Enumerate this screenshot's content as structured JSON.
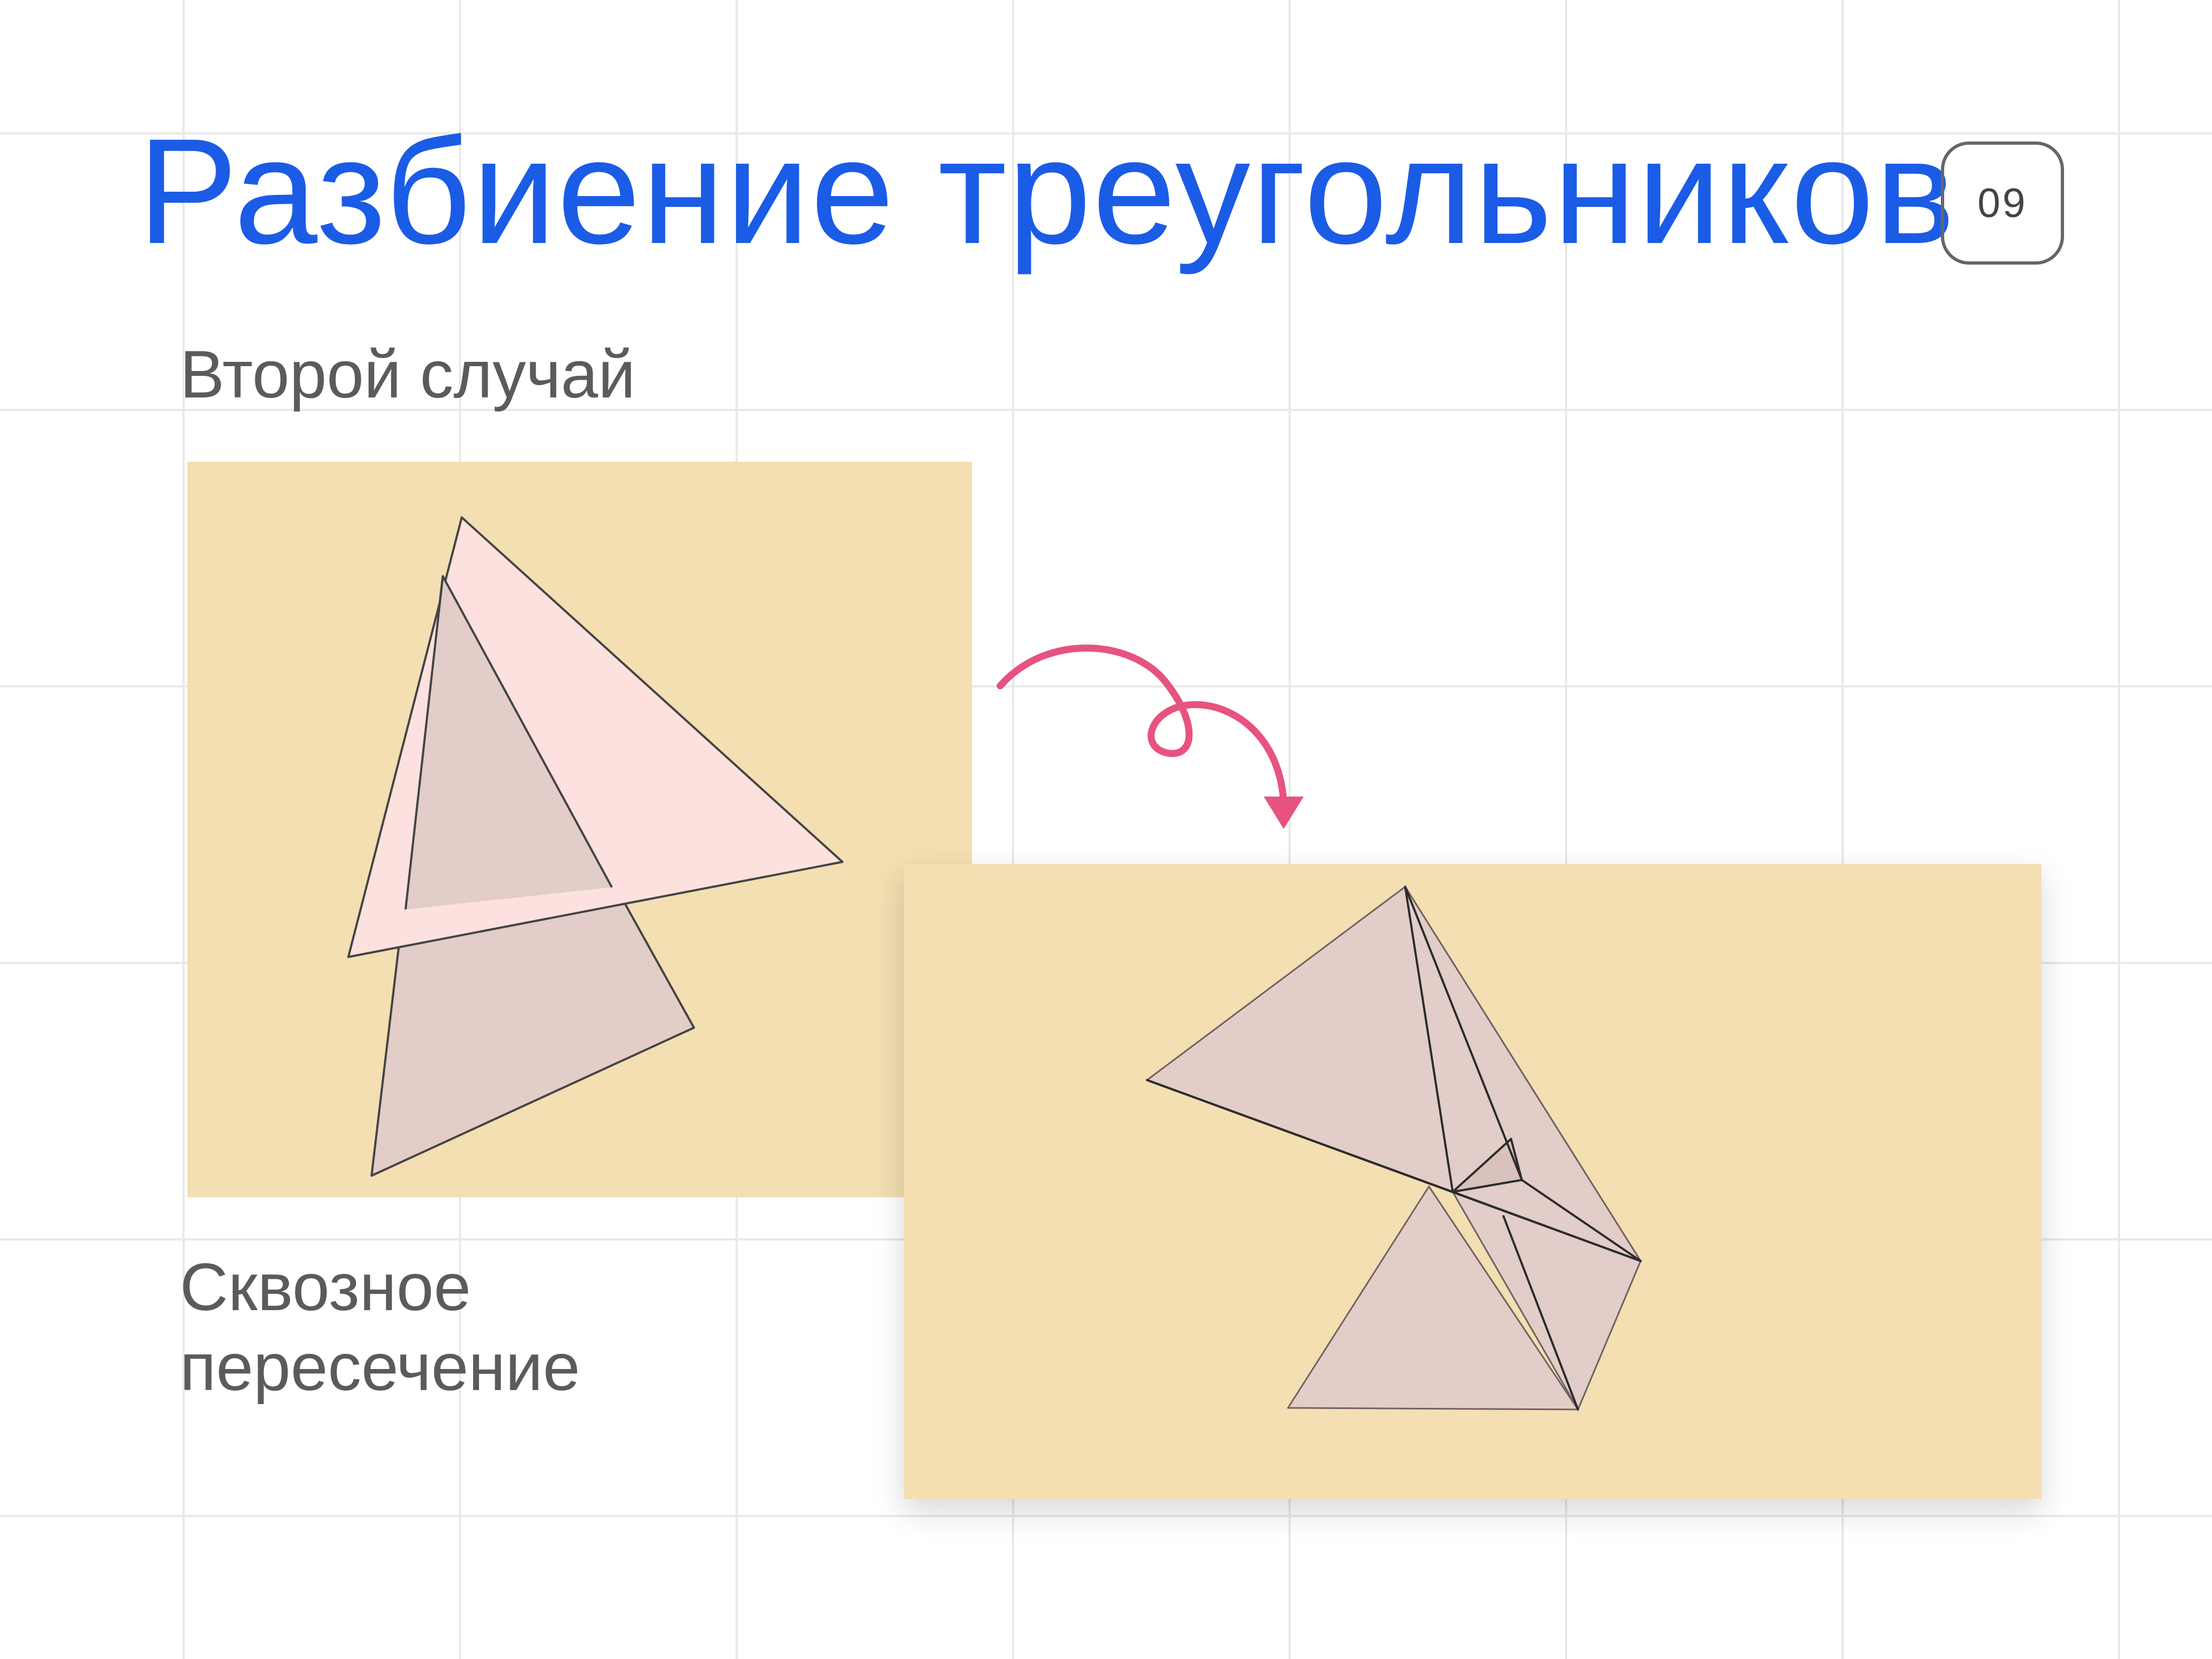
{
  "slide": {
    "title": "Разбиение треугольников",
    "page_number": "09",
    "subtitle": "Второй случай",
    "caption_lines": [
      "Сквозное",
      "пересечение"
    ]
  },
  "colors": {
    "title": "#1b5ce6",
    "panel": "#f3dfb1",
    "front_triangle": "#fde1df",
    "back_triangle": "#e2cdc8",
    "arrow": "#e8527e",
    "edge": "#3a3a3a"
  },
  "illustrations": {
    "before": "Треугольник с сквозным пересечением до разбиения",
    "after": "Треугольник после разбиения на части",
    "arrow_icon": "curly-arrow-down-icon"
  }
}
